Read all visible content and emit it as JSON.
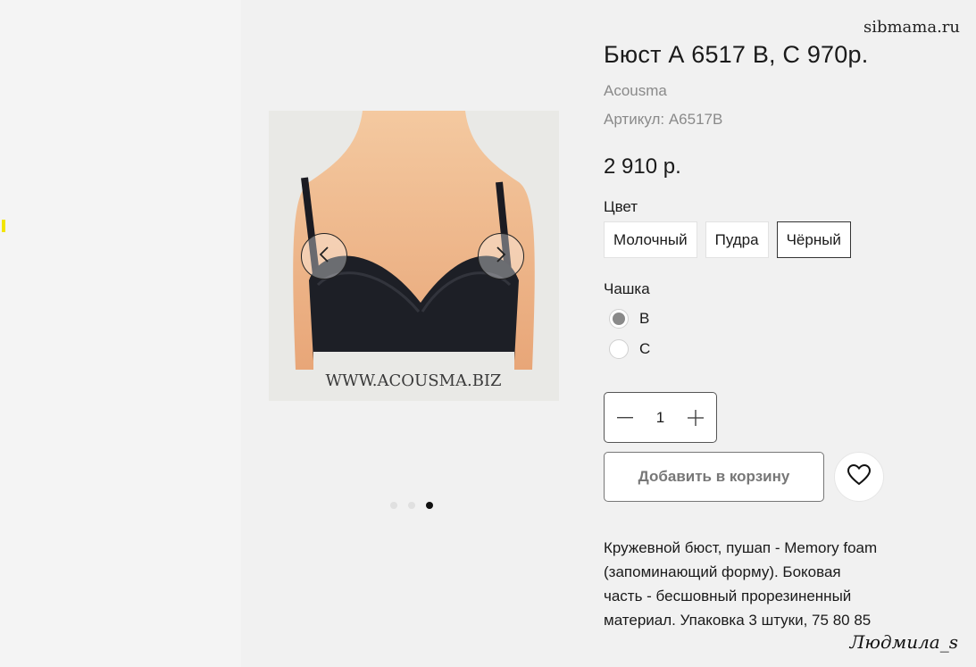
{
  "watermarks": {
    "site": "sibmama.ru",
    "author": "Людмила_s"
  },
  "gallery": {
    "image_caption": "WWW.ACOUSMA.BIZ",
    "prev_icon": "chevron-left-icon",
    "next_icon": "chevron-right-icon",
    "dots_count": 3,
    "active_dot": 3
  },
  "product": {
    "title": "Бюст А 6517 В, С 970р.",
    "brand": "Acousma",
    "sku": "Артикул: A6517B",
    "price": "2 910 р.",
    "color_label": "Цвет",
    "colors": [
      {
        "label": "Молочный",
        "selected": false
      },
      {
        "label": "Пудра",
        "selected": false
      },
      {
        "label": "Чёрный",
        "selected": true
      }
    ],
    "cup_label": "Чашка",
    "cups": [
      {
        "label": "B",
        "checked": true
      },
      {
        "label": "C",
        "checked": false
      }
    ],
    "quantity": "1",
    "add_to_cart": "Добавить в корзину",
    "favorite_icon": "heart-icon",
    "description": [
      "Кружевной бюст, пушап - Memory foam",
      "(запоминающий форму). Боковая",
      "часть - бесшовный прорезиненный",
      "материал. Упаковка 3 штуки, 75 80 85"
    ]
  },
  "colors": {
    "background": "#f1f1f1",
    "active_dot": "#111111",
    "selected_border": "#333333"
  }
}
